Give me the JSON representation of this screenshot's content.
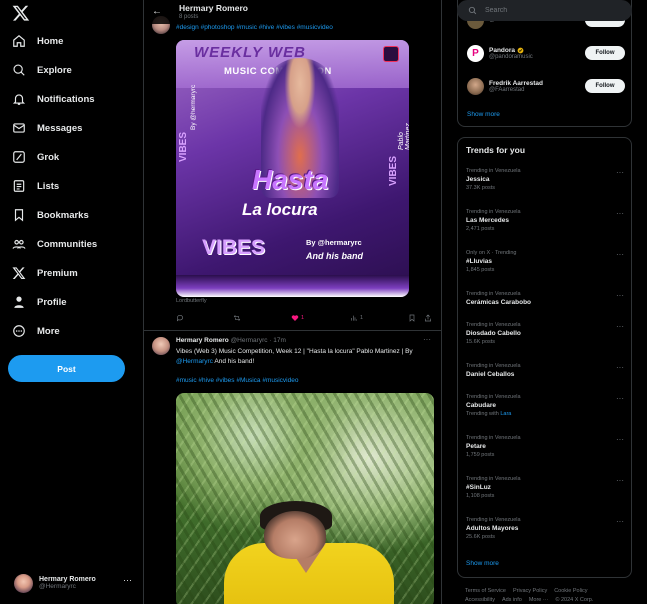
{
  "nav": {
    "items": [
      {
        "label": "Home",
        "icon": "home-icon"
      },
      {
        "label": "Explore",
        "icon": "search-icon"
      },
      {
        "label": "Notifications",
        "icon": "bell-icon"
      },
      {
        "label": "Messages",
        "icon": "mail-icon"
      },
      {
        "label": "Grok",
        "icon": "grok-icon"
      },
      {
        "label": "Lists",
        "icon": "list-icon"
      },
      {
        "label": "Bookmarks",
        "icon": "bookmark-icon"
      },
      {
        "label": "Communities",
        "icon": "people-icon"
      },
      {
        "label": "Premium",
        "icon": "x-logo-icon"
      },
      {
        "label": "Profile",
        "icon": "person-icon"
      },
      {
        "label": "More",
        "icon": "more-circle-icon"
      }
    ],
    "post_label": "Post",
    "account": {
      "name": "Hermary Romero",
      "handle": "@Hermaryrc"
    }
  },
  "header": {
    "name": "Hermary Romero",
    "post_count": "8 posts"
  },
  "tweet1": {
    "tags": "#design #photoshop #music #hive #vibes #musicvideo",
    "poster": {
      "top_title": "WEEKLY WEB",
      "competition": "MUSIC COMPETITION",
      "side_left": "VIBES",
      "side_right": "VIBES",
      "handle_vertical": "By @hermaryrc",
      "pablo": "Pablo Martinez",
      "song_line1": "Hasta",
      "song_line2": "La locura",
      "vibes_big": "VIBES",
      "by_line": "By @hermaryrc",
      "band_line": "And his band"
    },
    "credit": "Lordbutterfly",
    "likes": "1",
    "views": "1"
  },
  "tweet2": {
    "name": "Hermary Romero",
    "handle_time": "@Hermaryrc · 17m",
    "text_part1": "Vibes (Web 3) Music Competition, Week 12 | \"Hasta la locura\" Pablo Martinez | By ",
    "mention": "@Hermaryrc",
    "text_part2": " And his band!",
    "tags": "#music #hive #vibes #Musica #musicvideo"
  },
  "right": {
    "search_placeholder": "Search",
    "who_to_follow": [
      {
        "name": "",
        "handle": "@rosixBIT",
        "follow": "Follow",
        "avatar_color": "#6b5a3c"
      },
      {
        "name": "Pandora",
        "handle": "@pandoramusic",
        "follow": "Follow",
        "avatar_color": "#ffffff",
        "verified": true
      },
      {
        "name": "Fredrik Aarrestad",
        "handle": "@FAarrestad",
        "follow": "Follow",
        "avatar_color": "#8a6a50"
      }
    ],
    "show_more": "Show more",
    "trends_title": "Trends for you",
    "trends": [
      {
        "context": "Trending in Venezuela",
        "name": "Jessica",
        "count": "37.3K posts"
      },
      {
        "context": "Trending in Venezuela",
        "name": "Las Mercedes",
        "count": "2,471 posts"
      },
      {
        "context": "Only on X · Trending",
        "name": "#Lluvias",
        "count": "1,845 posts"
      },
      {
        "context": "Trending in Venezuela",
        "name": "Cerámicas Carabobo",
        "count": ""
      },
      {
        "context": "Trending in Venezuela",
        "name": "Diosdado Cabello",
        "count": "15.6K posts"
      },
      {
        "context": "Trending in Venezuela",
        "name": "Daniel Ceballos",
        "count": ""
      },
      {
        "context": "Trending in Venezuela",
        "name": "Cabudare",
        "count_prefix": "Trending with ",
        "count_link": "Lara"
      },
      {
        "context": "Trending in Venezuela",
        "name": "Petare",
        "count": "1,759 posts"
      },
      {
        "context": "Trending in Venezuela",
        "name": "#SinLuz",
        "count": "1,108 posts"
      },
      {
        "context": "Trending in Venezuela",
        "name": "Adultos Mayores",
        "count": "25.6K posts"
      }
    ],
    "show_more2": "Show more",
    "footer": [
      "Terms of Service",
      "Privacy Policy",
      "Cookie Policy",
      "Accessibility",
      "Ads info",
      "More ···",
      "© 2024 X Corp."
    ]
  },
  "colors": {
    "accent": "#1d9bf0",
    "background": "#000000",
    "like": "#f91880"
  }
}
